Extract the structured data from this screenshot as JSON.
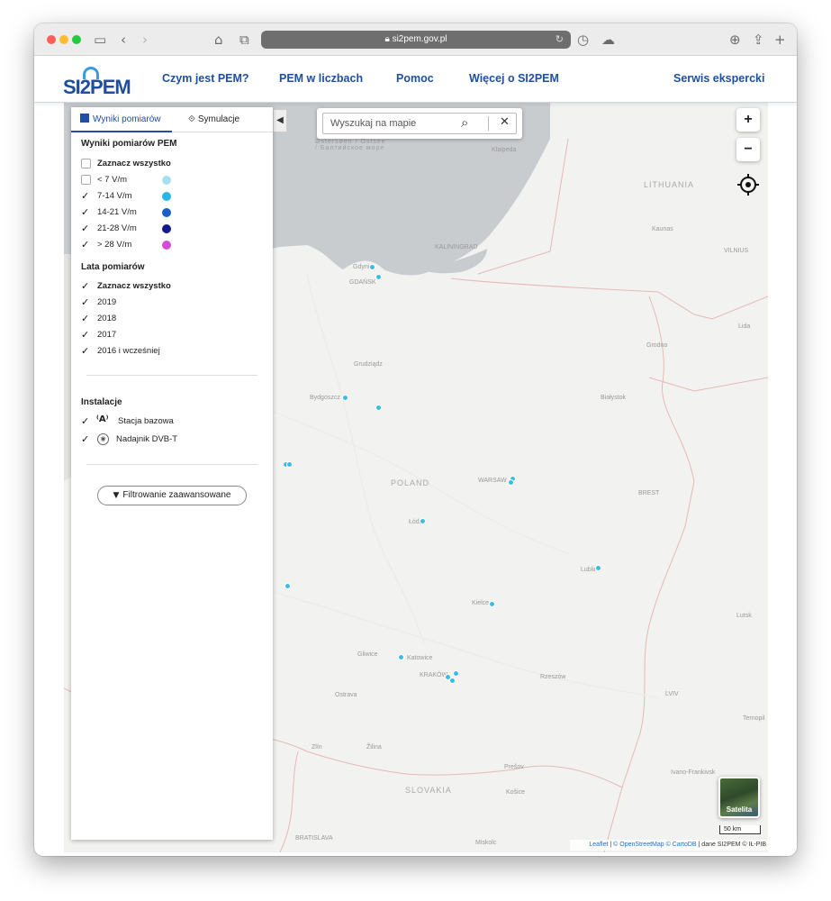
{
  "browser": {
    "url": "si2pem.gov.pl"
  },
  "header": {
    "logo_text": "SI2PEM",
    "nav": [
      "Czym jest PEM?",
      "PEM w liczbach",
      "Pomoc",
      "Więcej o SI2PEM"
    ],
    "expert_link": "Serwis ekspercki"
  },
  "panel": {
    "tabs": {
      "results": "Wyniki pomiarów",
      "simulation": "Symulacje"
    },
    "results_title": "Wyniki pomiarów PEM",
    "select_all": "Zaznacz wszystko",
    "levels": [
      {
        "label": "< 7 V/m",
        "checked": false,
        "color": "#a8def0"
      },
      {
        "label": "7-14 V/m",
        "checked": true,
        "color": "#2bb6e6"
      },
      {
        "label": "14-21 V/m",
        "checked": true,
        "color": "#1a5fc4"
      },
      {
        "label": "21-28 V/m",
        "checked": true,
        "color": "#151a8a"
      },
      {
        "label": "> 28 V/m",
        "checked": true,
        "color": "#d64bd6"
      }
    ],
    "years_title": "Lata pomiarów",
    "years": [
      "2019",
      "2018",
      "2017",
      "2016 i wcześniej"
    ],
    "installations_title": "Instalacje",
    "installations": [
      "Stacja bazowa",
      "Nadajnik DVB-T"
    ],
    "filter_button": "Filtrowanie zaawansowane"
  },
  "search": {
    "placeholder": "Wyszukaj na mapie"
  },
  "map": {
    "zoom_in": "+",
    "zoom_out": "−",
    "satellite_label": "Satelita",
    "scale_label": "50 km",
    "attribution_prefix": "Leaflet",
    "attribution_osm": "© OpenStreetMap",
    "attribution_carto": "© CartoDB",
    "attribution_suffix": "| dane SI2PEM © IŁ-PIB",
    "sea_label": "Østersøen / Ostsee / Балтийское море",
    "country_labels": [
      "LITHUANIA",
      "POLAND",
      "SLOVAKIA"
    ],
    "city_labels": [
      "Klaipeda",
      "Kaunas",
      "VILNIUS",
      "KALININGRAD",
      "Gdynia",
      "GDAŃSK",
      "Lida",
      "Grodno",
      "Grudziądz",
      "Bydgoszcz",
      "Białystok",
      "WARSAW",
      "BREST",
      "Łódź",
      "Lublin",
      "Kielce",
      "Lutsk",
      "Gliwice",
      "Katowice",
      "KRAKÓW",
      "Rzeszów",
      "Ostrava",
      "LVIV",
      "Ternopil",
      "Zlín",
      "Žilina",
      "Prešov",
      "Ivano-Frankivsk",
      "Košice",
      "BRATISLAVA",
      "Miskolc"
    ]
  }
}
